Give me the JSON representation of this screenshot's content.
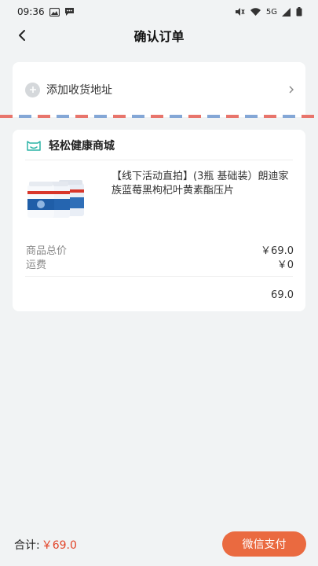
{
  "status_bar": {
    "time": "09:36",
    "network": "5G"
  },
  "header": {
    "title": "确认订单"
  },
  "address": {
    "add_label": "添加收货地址"
  },
  "shop": {
    "name": "轻松健康商城"
  },
  "product": {
    "title": "【线下活动直拍】(3瓶 基础装）朗迪家族蓝莓黑枸杞叶黄素酯压片"
  },
  "summary": {
    "goods_total_label": "商品总价",
    "goods_total_value": "￥69.0",
    "shipping_label": "运费",
    "shipping_value": "￥0",
    "subtotal_value": "69.0"
  },
  "footer": {
    "total_label": "合计:",
    "total_price": "￥69.0",
    "pay_button": "微信支付"
  },
  "colors": {
    "accent": "#ea6a40",
    "price": "#e2462a",
    "shop_icon": "#2bb3a6"
  },
  "icons": [
    "back-arrow-icon",
    "plus-icon",
    "chevron-right-icon",
    "shop-icon"
  ]
}
